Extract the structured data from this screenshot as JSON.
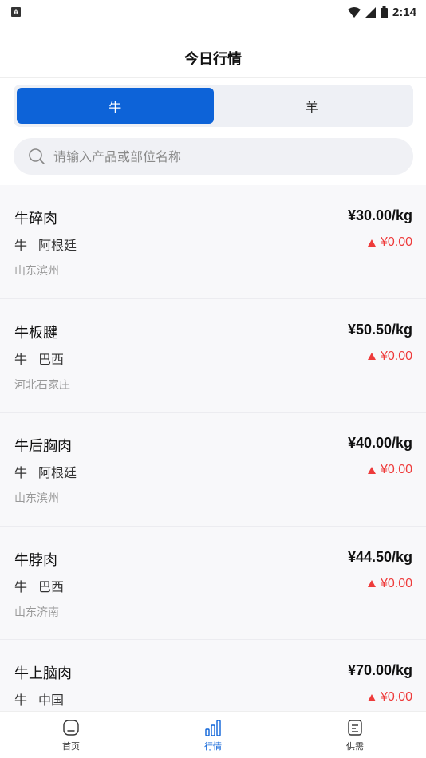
{
  "status_bar": {
    "time": "2:14",
    "sim_label": "A"
  },
  "header": {
    "title": "今日行情"
  },
  "tabs": [
    {
      "label": "牛",
      "active": true
    },
    {
      "label": "羊",
      "active": false
    }
  ],
  "search": {
    "placeholder": "请输入产品或部位名称"
  },
  "items": [
    {
      "name": "牛碎肉",
      "category": "牛",
      "origin": "阿根廷",
      "location": "山东滨州",
      "price": "¥30.00/kg",
      "change": "¥0.00"
    },
    {
      "name": "牛板腱",
      "category": "牛",
      "origin": "巴西",
      "location": "河北石家庄",
      "price": "¥50.50/kg",
      "change": "¥0.00"
    },
    {
      "name": "牛后胸肉",
      "category": "牛",
      "origin": "阿根廷",
      "location": "山东滨州",
      "price": "¥40.00/kg",
      "change": "¥0.00"
    },
    {
      "name": "牛脖肉",
      "category": "牛",
      "origin": "巴西",
      "location": "山东济南",
      "price": "¥44.50/kg",
      "change": "¥0.00"
    },
    {
      "name": "牛上脑肉",
      "category": "牛",
      "origin": "中国",
      "location": "",
      "price": "¥70.00/kg",
      "change": "¥0.00"
    }
  ],
  "bottom_nav": [
    {
      "label": "首页",
      "icon": "home-icon",
      "active": false
    },
    {
      "label": "行情",
      "icon": "chart-icon",
      "active": true
    },
    {
      "label": "供需",
      "icon": "document-icon",
      "active": false
    }
  ],
  "colors": {
    "accent": "#0d63d8",
    "up": "#ee3b3b"
  }
}
